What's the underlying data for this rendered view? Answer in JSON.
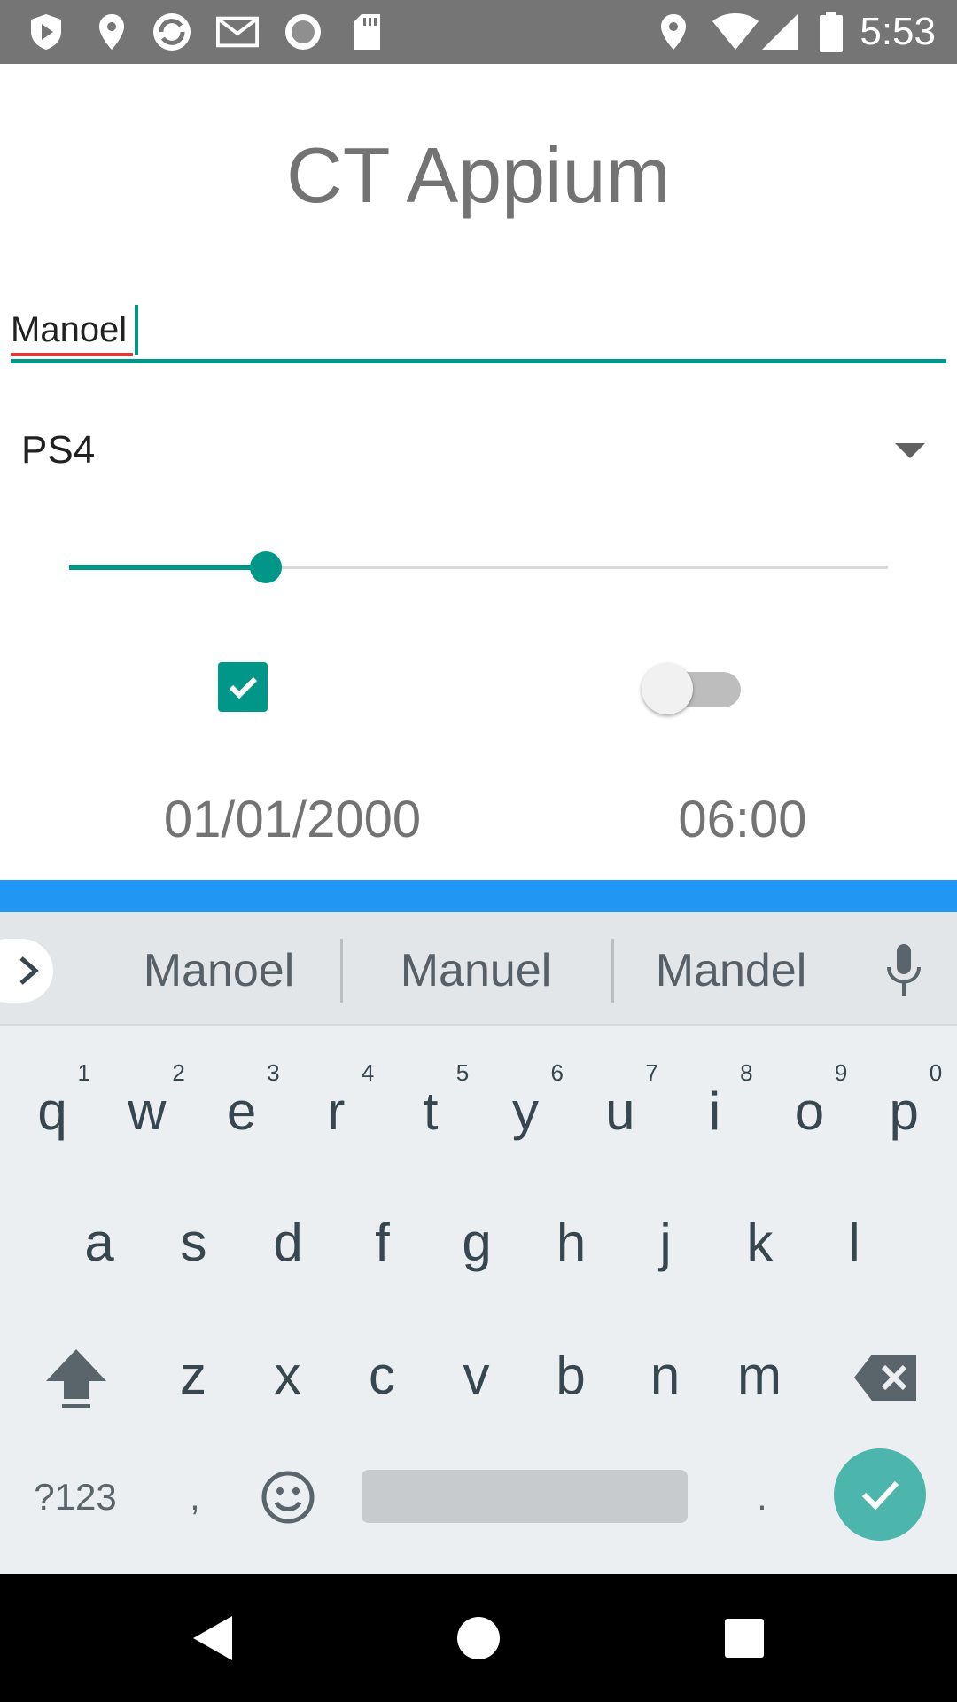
{
  "status_bar": {
    "time": "5:53",
    "left_icons": [
      "shield-icon",
      "location-icon",
      "sync-icon",
      "gmail-icon",
      "record-icon",
      "sd-card-icon"
    ],
    "right_icons": [
      "location-icon",
      "wifi-icon",
      "signal-icon",
      "battery-icon"
    ]
  },
  "app": {
    "title": "CT Appium",
    "name_field_value": "Manoel",
    "console_spinner_value": "PS4",
    "slider_fraction": 0.24,
    "checkbox_checked": true,
    "switch_on": false,
    "date": "01/01/2000",
    "time": "06:00"
  },
  "colors": {
    "accent": "#009688",
    "keyboard_bar": "#2196f3",
    "status_bar": "#757575",
    "done_key": "#4db6ac"
  },
  "keyboard": {
    "suggestions": [
      "Manoel",
      "Manuel",
      "Mandel"
    ],
    "row1": [
      {
        "key": "q",
        "hint": "1"
      },
      {
        "key": "w",
        "hint": "2"
      },
      {
        "key": "e",
        "hint": "3"
      },
      {
        "key": "r",
        "hint": "4"
      },
      {
        "key": "t",
        "hint": "5"
      },
      {
        "key": "y",
        "hint": "6"
      },
      {
        "key": "u",
        "hint": "7"
      },
      {
        "key": "i",
        "hint": "8"
      },
      {
        "key": "o",
        "hint": "9"
      },
      {
        "key": "p",
        "hint": "0"
      }
    ],
    "row2": [
      "a",
      "s",
      "d",
      "f",
      "g",
      "h",
      "j",
      "k",
      "l"
    ],
    "row3": [
      "z",
      "x",
      "c",
      "v",
      "b",
      "n",
      "m"
    ],
    "symbols_key": "?123",
    "comma_key": ",",
    "period_key": "."
  }
}
